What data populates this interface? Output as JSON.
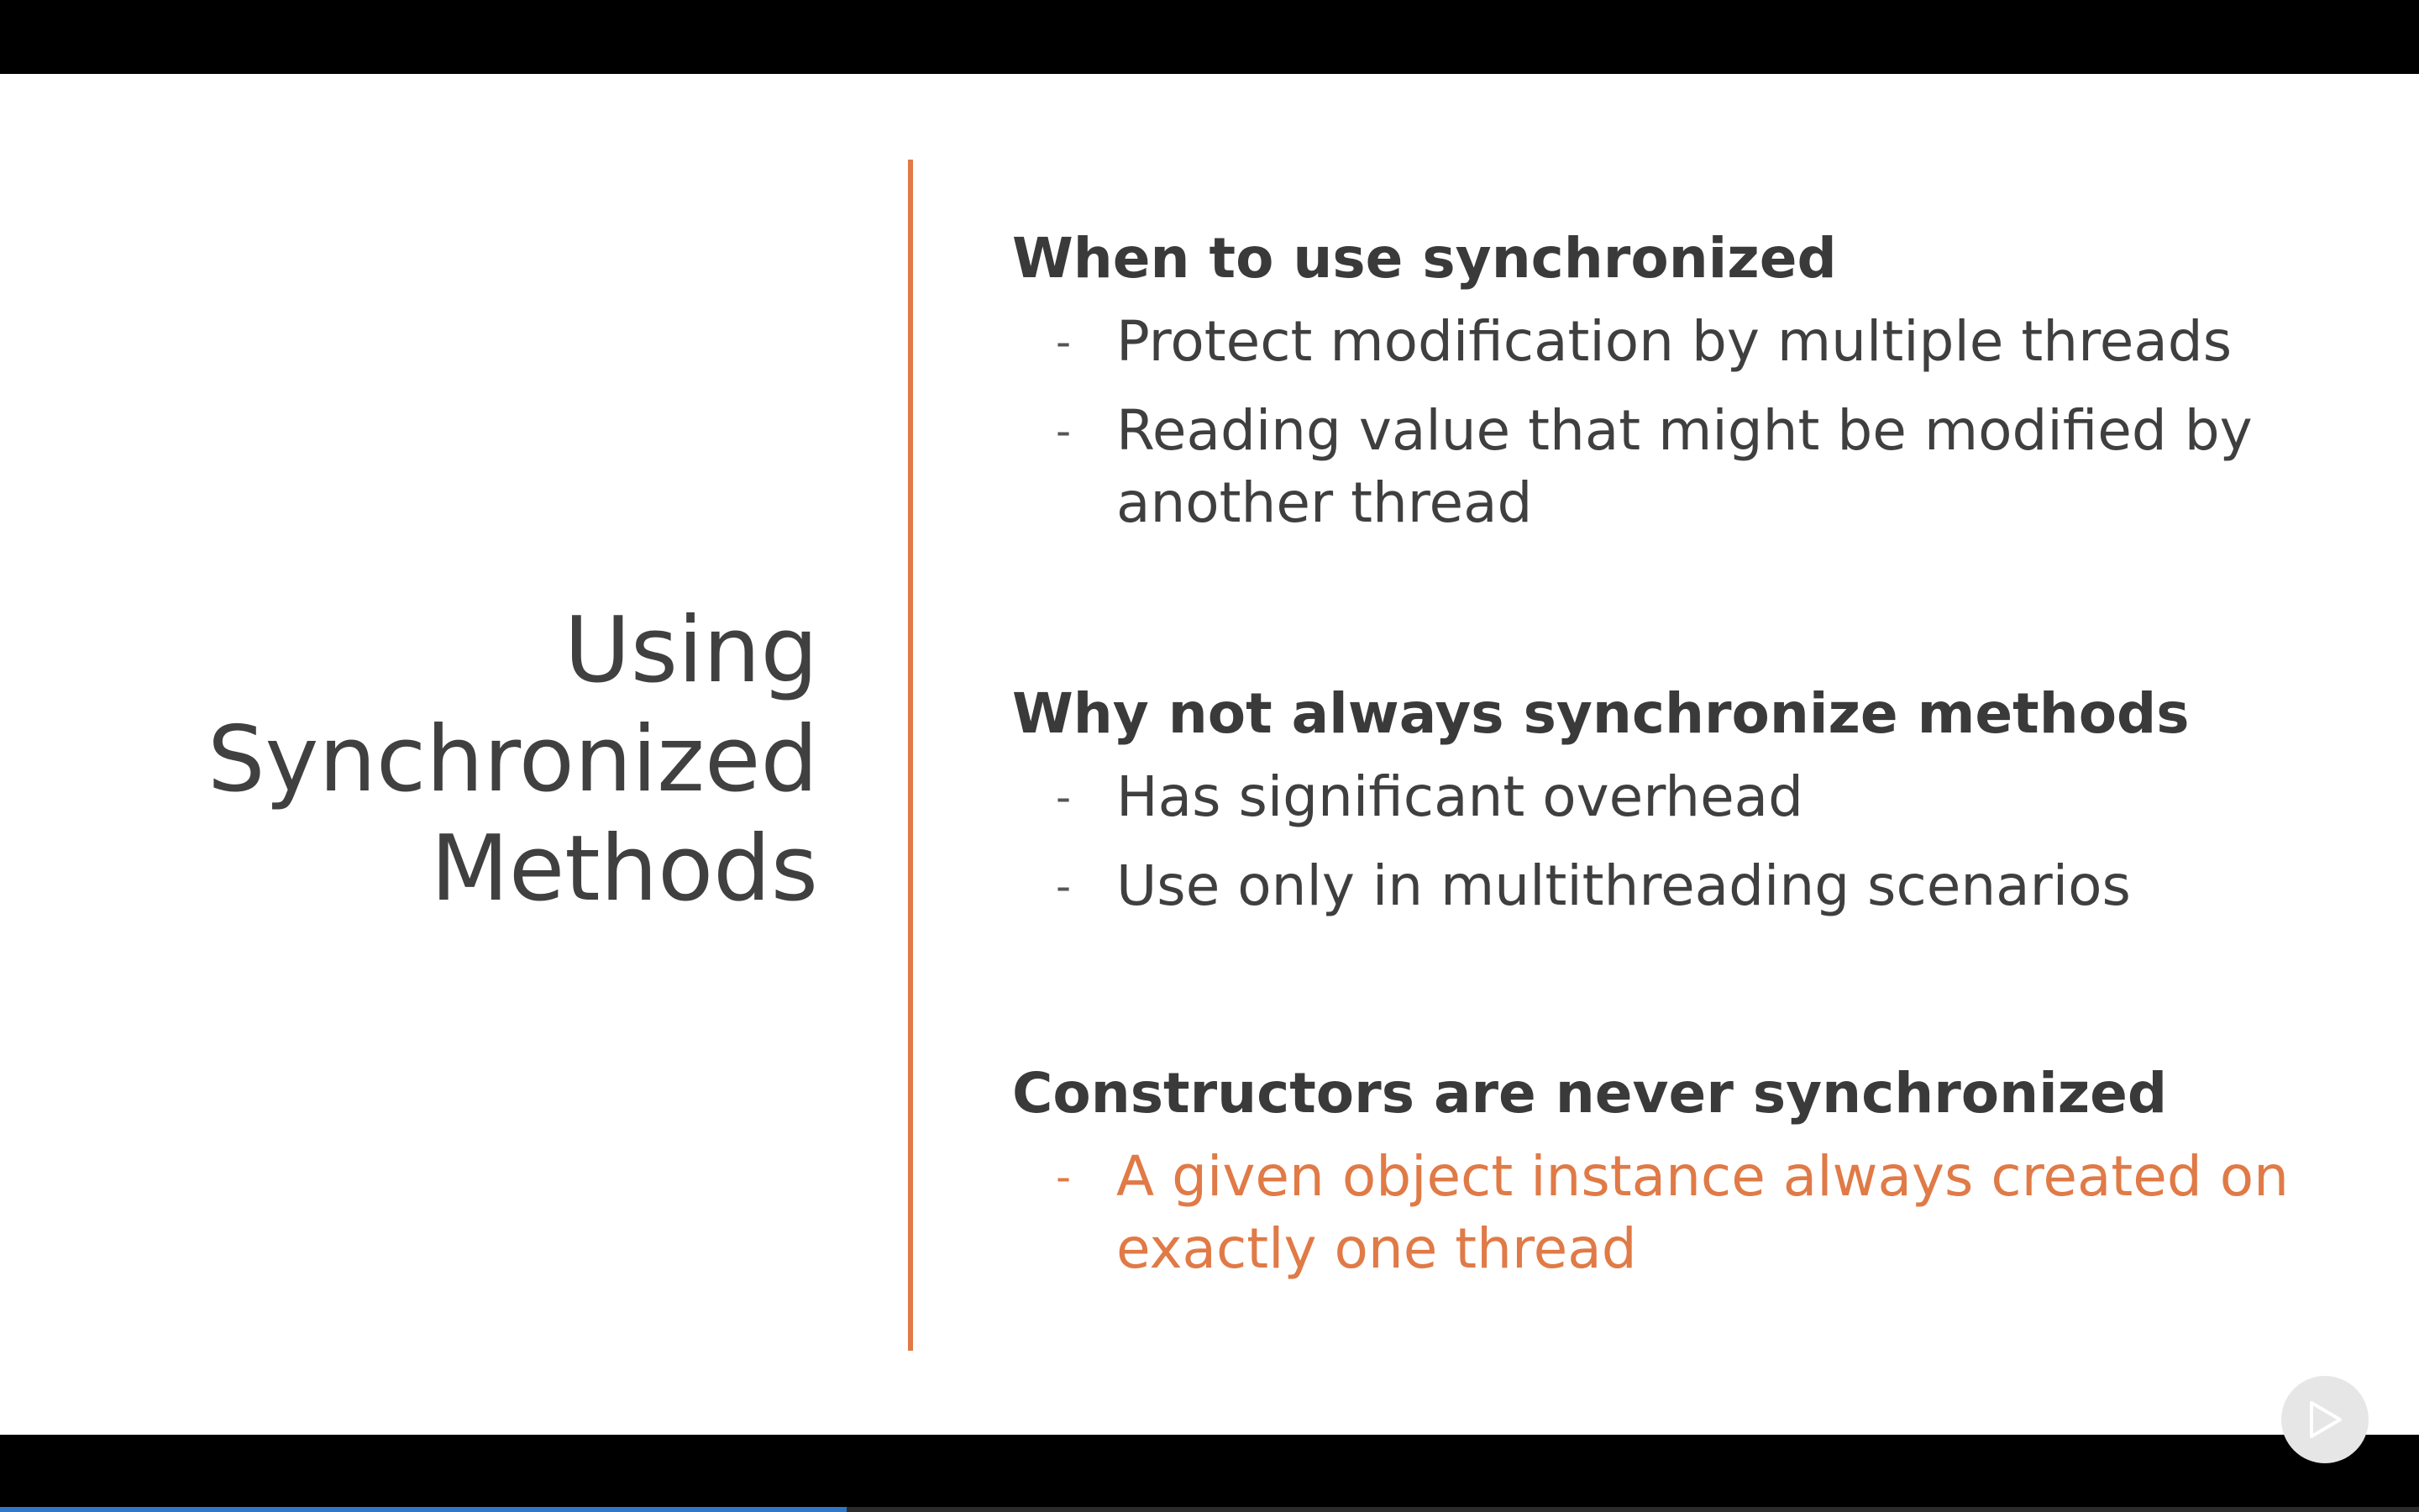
{
  "slide": {
    "title_lines": [
      "Using",
      "Synchronized",
      "Methods"
    ],
    "sections": [
      {
        "heading": "When to use synchronized",
        "bullets": [
          "Protect modification by multiple threads",
          "Reading value that might be modified by another thread"
        ]
      },
      {
        "heading": "Why not always synchronize methods",
        "bullets": [
          "Has significant overhead",
          "Use only in multithreading scenarios"
        ]
      },
      {
        "heading": "Constructors are never synchronized",
        "bullets": [
          "A given object instance always created on exactly one thread"
        ]
      }
    ],
    "bullet_marker": "-"
  },
  "player": {
    "play_icon": "play-icon",
    "progress_fraction": 0.35
  },
  "colors": {
    "accent": "#e07a46",
    "text": "#3f3f3f",
    "progress": "#2f78c8"
  }
}
